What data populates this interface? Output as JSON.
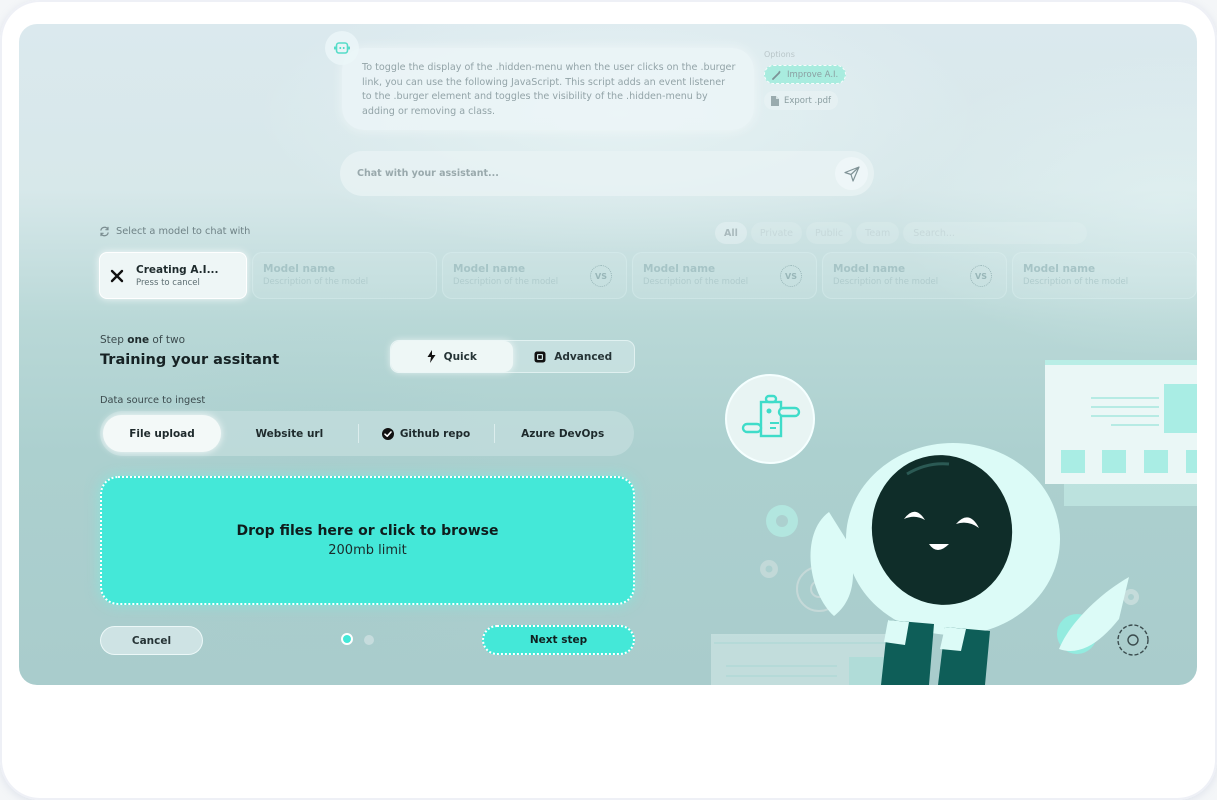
{
  "chat": {
    "message": "To toggle the display of the .hidden-menu when the user clicks on the .burger link, you can use the following JavaScript. This script adds an event listener to the .burger element and toggles the visibility of the .hidden-menu by adding or removing a class.",
    "options_label": "Options",
    "options": [
      {
        "label": "Improve A.I.",
        "icon": "magic-wand-icon"
      },
      {
        "label": "Export .pdf",
        "icon": "document-icon"
      }
    ],
    "input_placeholder": "Chat with your assistant...",
    "send_icon": "paper-plane-icon"
  },
  "model_selector": {
    "label": "Select a model to chat with",
    "filters": [
      "All",
      "Private",
      "Public",
      "Team"
    ],
    "active_filter": "All",
    "search_placeholder": "Search...",
    "creating": {
      "title": "Creating A.I...",
      "subtitle": "Press to cancel"
    },
    "models": [
      {
        "name": "Model name",
        "description": "Description of the model",
        "vs": false
      },
      {
        "name": "Model name",
        "description": "Description of the model",
        "vs": true
      },
      {
        "name": "Model name",
        "description": "Description of the model",
        "vs": true
      },
      {
        "name": "Model name",
        "description": "Description of the model",
        "vs": true
      },
      {
        "name": "Model name",
        "description": "Description of the model",
        "vs": false
      }
    ],
    "vs_label": "VS"
  },
  "training": {
    "step_prefix": "Step",
    "step_current": "one",
    "step_suffix": "of two",
    "title": "Training your assitant",
    "modes": [
      {
        "label": "Quick",
        "active": true
      },
      {
        "label": "Advanced",
        "active": false
      }
    ],
    "source_label": "Data source to ingest",
    "sources": [
      {
        "label": "File upload",
        "active": true
      },
      {
        "label": "Website url",
        "active": false
      },
      {
        "label": "Github repo",
        "active": false,
        "checked": true
      },
      {
        "label": "Azure DevOps",
        "active": false
      }
    ],
    "dropzone": {
      "title": "Drop files here or click to browse",
      "subtitle": "200mb limit"
    },
    "cancel_label": "Cancel",
    "next_label": "Next step",
    "progress": {
      "current_step": 1,
      "total_steps": 2
    }
  },
  "colors": {
    "accent": "#44e8d8",
    "dark": "#0f1d1d"
  }
}
